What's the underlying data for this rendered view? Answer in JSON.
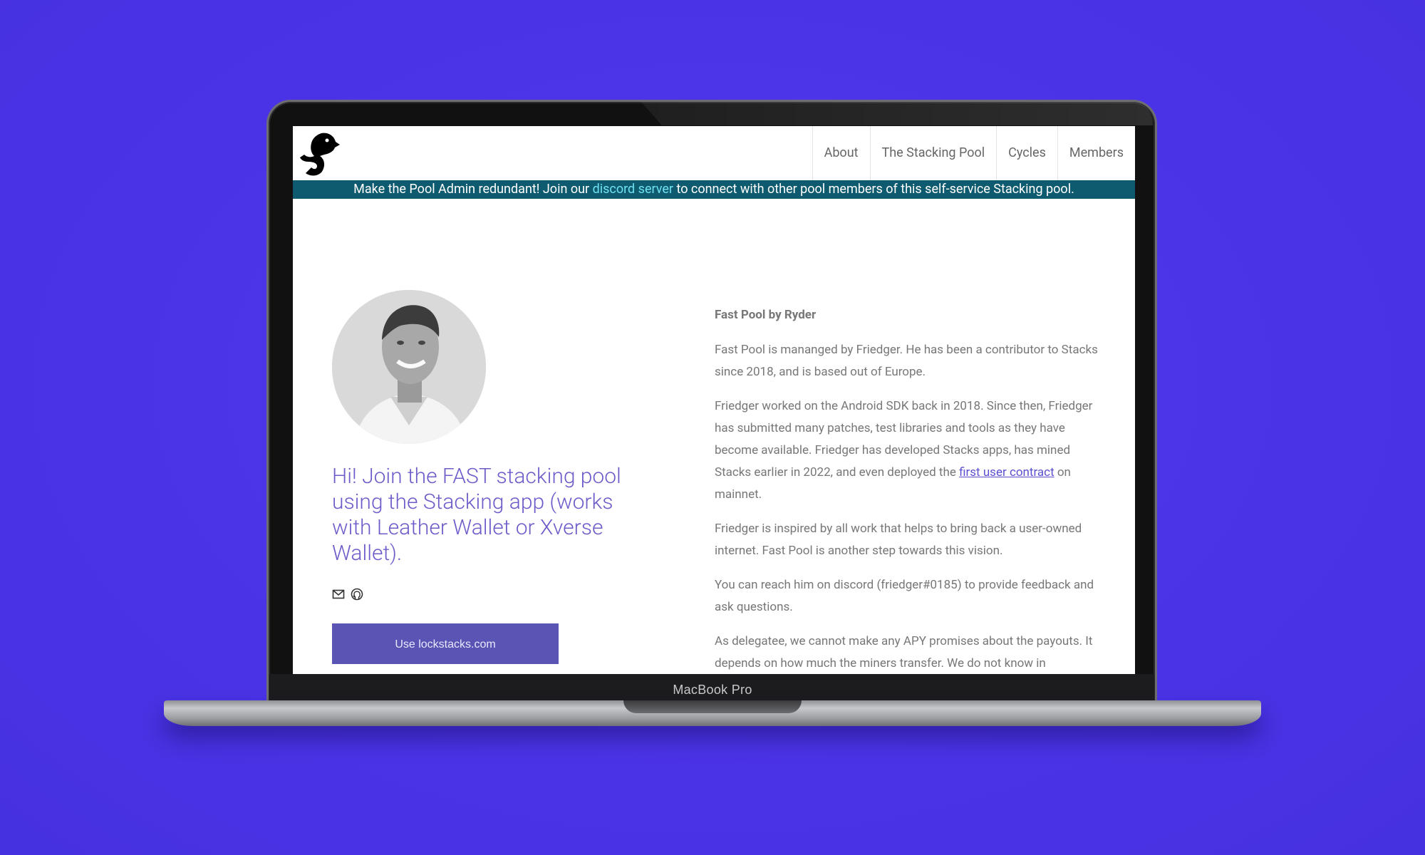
{
  "device": {
    "label": "MacBook Pro"
  },
  "nav": {
    "logo": "stacks-duck-logo",
    "items": [
      {
        "label": "About"
      },
      {
        "label": "The Stacking Pool"
      },
      {
        "label": "Cycles"
      },
      {
        "label": "Members"
      }
    ]
  },
  "banner": {
    "text_before": "Make the Pool Admin redundant! Join our ",
    "link": "discord server",
    "text_after": " to connect with other pool members of this self-service Stacking pool."
  },
  "profile": {
    "headline": "Hi! Join the FAST stacking pool using the Stacking app (works with Leather Wallet or Xverse Wallet).",
    "icons": [
      "mail-icon",
      "github-icon"
    ],
    "cta": "Use lockstacks.com"
  },
  "about": {
    "title": "Fast Pool by Ryder",
    "p1": "Fast Pool is mananged by Friedger. He has been a contributor to Stacks since 2018, and is based out of Europe.",
    "p2_before": "Friedger worked on the Android SDK back in 2018. Since then, Friedger has submitted many patches, test libraries and tools as they have become available. Friedger has developed Stacks apps, has mined Stacks earlier in 2022, and even deployed the ",
    "p2_link": "first user contract",
    "p2_after": " on mainnet.",
    "p3": "Friedger is inspired by all work that helps to bring back a user-owned internet. Fast Pool is another step towards this vision.",
    "p4": "You can reach him on discord (friedger#0185) to provide feedback and ask questions.",
    "p5": "As delegatee, we cannot make any APY promises about the payouts. It depends on how much the miners transfer. We do not know in"
  },
  "colors": {
    "background": "#4a33e6",
    "banner": "#0e5b70",
    "accent": "#5a55b5",
    "link": "#6fe0f2"
  }
}
